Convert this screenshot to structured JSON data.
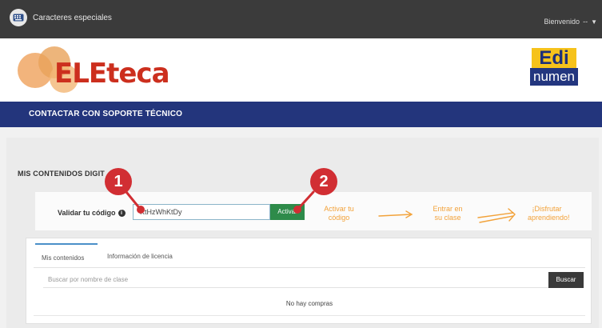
{
  "topbar": {
    "special_chars_label": "Caracteres especiales",
    "greeting": "Bienvenido",
    "greeting_suffix": "--"
  },
  "header": {
    "logo_text": "ELEteca",
    "partner_logo_top": "Edi",
    "partner_logo_bottom": "numen"
  },
  "nav": {
    "support_link": "CONTACTAR CON SOPORTE TÉCNICO"
  },
  "main": {
    "section_title": "MIS CONTENIDOS DIGIT",
    "validate_label": "Validar tu código",
    "info_icon_glyph": "i",
    "code_value": "KtHzWhKtDy",
    "activate_label": "Activar",
    "steps": [
      "Activar tu código",
      "Entrar en su clase",
      "¡Disfrutar aprendiendo!"
    ],
    "badges": [
      "1",
      "2"
    ]
  },
  "panel": {
    "tabs": [
      "Mis contenidos",
      "Información de licencia"
    ],
    "search_placeholder": "Buscar por nombre de clase",
    "search_button": "Buscar",
    "empty_message": "No hay compras"
  },
  "colors": {
    "topbar_bg": "#3b3b3b",
    "nav_bg": "#23357c",
    "logo_red": "#cc2f1e",
    "activate_green": "#2e8b4a",
    "badge_red": "#d12e33",
    "step_orange": "#f2a23a"
  },
  "icons": {
    "special_chars": "keyboard-icon",
    "info": "info-icon",
    "user_menu": "chevron-down-icon"
  }
}
